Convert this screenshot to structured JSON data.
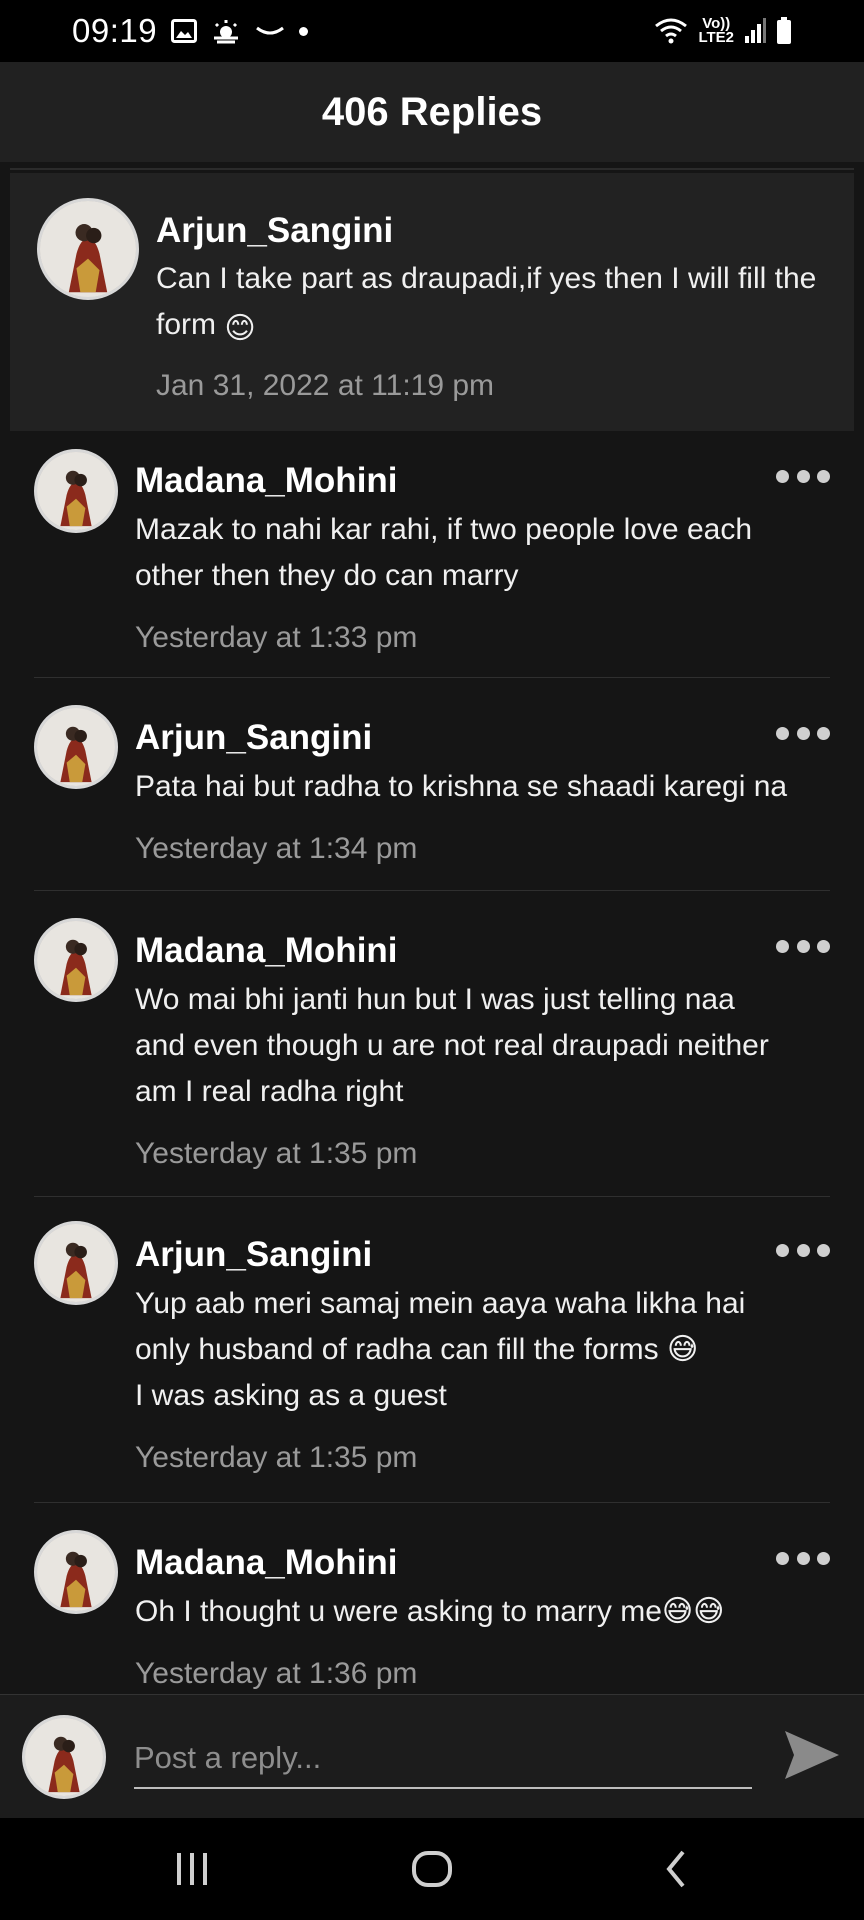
{
  "status_bar": {
    "time": "09:19",
    "lte_top": "Vo))",
    "lte_bottom": "LTE2",
    "icons": [
      "gallery-icon",
      "weather-icon",
      "swoosh-icon",
      "dot-icon",
      "wifi-icon",
      "signal-icon",
      "battery-icon"
    ]
  },
  "header": {
    "title": "406 Replies"
  },
  "parent_comment": {
    "author": "Arjun_Sangini",
    "text": "Can I take part as draupadi,if yes then I will fill the form",
    "emoji": "😊",
    "time": "Jan 31, 2022 at 11:19 pm"
  },
  "replies": [
    {
      "author": "Madana_Mohini",
      "lines": [
        "Mazak to nahi kar rahi, if two people love each",
        "other then they do can marry"
      ],
      "time": "Yesterday at 1:33 pm"
    },
    {
      "author": "Arjun_Sangini",
      "lines": [
        "Pata hai but radha to krishna se shaadi karegi na"
      ],
      "time": "Yesterday at 1:34 pm"
    },
    {
      "author": "Madana_Mohini",
      "lines": [
        "Wo mai bhi janti hun but I was just telling naa",
        "and even though u are not real draupadi neither",
        "am I real radha right"
      ],
      "time": "Yesterday at 1:35 pm"
    },
    {
      "author": "Arjun_Sangini",
      "lines": [
        "Yup aab meri samaj mein aaya waha likha hai",
        "only husband of radha can fill the forms 😅",
        "I was asking as a guest"
      ],
      "time": "Yesterday at 1:35 pm"
    },
    {
      "author": "Madana_Mohini",
      "lines": [
        "Oh I thought u were asking to marry me😅😅"
      ],
      "time": "Yesterday at 1:36 pm"
    }
  ],
  "reply_bar": {
    "placeholder": "Post a reply..."
  },
  "nav": {
    "buttons": [
      "recents-icon",
      "home-icon",
      "back-icon"
    ]
  },
  "colors": {
    "background": "#151515",
    "header": "#212121",
    "timestamp": "#9a9a9a"
  }
}
